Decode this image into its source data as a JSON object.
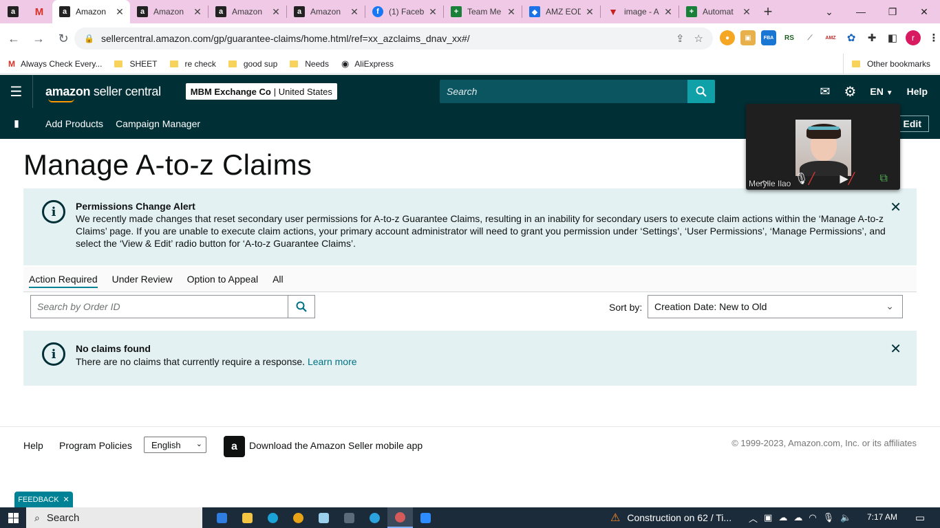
{
  "browser": {
    "tabs": [
      {
        "title": "",
        "icon": "amazon-icon",
        "pinned": true
      },
      {
        "title": "",
        "icon": "gmail-icon",
        "pinned": true
      },
      {
        "title": "Amazon",
        "icon": "amazon-icon",
        "active": true
      },
      {
        "title": "Amazon",
        "icon": "amazon-icon"
      },
      {
        "title": "Amazon",
        "icon": "amazon-icon"
      },
      {
        "title": "Amazon",
        "icon": "amazon-icon"
      },
      {
        "title": "(1) Faceb",
        "icon": "facebook-icon"
      },
      {
        "title": "Team Me",
        "icon": "sheets-icon"
      },
      {
        "title": "AMZ EOD",
        "icon": "amz-eod-icon"
      },
      {
        "title": "image - A",
        "icon": "image-icon"
      },
      {
        "title": "Automat",
        "icon": "sheets-icon"
      }
    ],
    "url": "sellercentral.amazon.com/gp/guarantee-claims/home.html/ref=xx_azclaims_dnav_xx#/",
    "bookmarks": [
      {
        "label": "Always Check Every...",
        "icon": "gmail-icon"
      },
      {
        "label": "SHEET",
        "icon": "folder-icon"
      },
      {
        "label": "re check",
        "icon": "folder-icon"
      },
      {
        "label": "good sup",
        "icon": "folder-icon"
      },
      {
        "label": "Needs",
        "icon": "folder-icon"
      },
      {
        "label": "AliExpress",
        "icon": "globe-icon"
      }
    ],
    "other_bookmarks": "Other bookmarks",
    "profile_initial": "r"
  },
  "header": {
    "logo_main": "amazon",
    "logo_sub": "seller central",
    "account_name": "MBM Exchange Co",
    "account_market": "United States",
    "search_placeholder": "Search",
    "language": "EN",
    "help": "Help"
  },
  "nav": {
    "items": [
      "Add Products",
      "Campaign Manager"
    ],
    "edit": "Edit"
  },
  "meeting": {
    "participant": "Merylle Ilao"
  },
  "page": {
    "title": "Manage A-to-z Claims",
    "permissions_alert": {
      "title": "Permissions Change Alert",
      "body": "We recently made changes that reset secondary user permissions for A-to-z Guarantee Claims, resulting in an inability for secondary users to execute claim actions within the ‘Manage A-to-z Claims’ page. If you are unable to execute claim actions, your primary account administrator will need to grant you permission under ‘Settings’, ‘User Permissions’, ‘Manage Permissions’, and select the ‘View & Edit’ radio button for ‘A-to-z Guarantee Claims’."
    },
    "tabs": [
      "Action Required",
      "Under Review",
      "Option to Appeal",
      "All"
    ],
    "search_placeholder": "Search by Order ID",
    "sort_label": "Sort by:",
    "sort_value": "Creation Date: New to Old",
    "no_claims_alert": {
      "title": "No claims found",
      "body": "There are no claims that currently require a response.",
      "link": "Learn more"
    }
  },
  "footer": {
    "help": "Help",
    "program_policies": "Program Policies",
    "language": "English",
    "app_download": "Download the Amazon Seller mobile app",
    "copyright": "© 1999-2023, Amazon.com, Inc. or its affiliates"
  },
  "feedback": "FEEDBACK",
  "taskbar": {
    "search": "Search",
    "news": "Construction on 62 / Ti...",
    "time": "7:17 AM"
  },
  "colors": {
    "header_bg": "#002f36",
    "alert_bg": "#e3f1f2",
    "accent": "#008296",
    "tabstrip_bg": "#f0c9e6"
  }
}
